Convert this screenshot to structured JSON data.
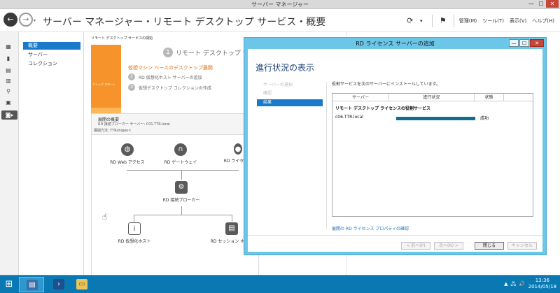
{
  "window": {
    "title": "サーバー マネージャー",
    "minimize": "—",
    "maximize": "☐",
    "close": "✕"
  },
  "header": {
    "back": "←",
    "forward": "→",
    "nav_dropdown": "▾",
    "breadcrumb": "サーバー マネージャー・リモート デスクトップ サービス・概要",
    "refresh_icon": "⟳",
    "flag_icon": "⚑",
    "menus": [
      "管理(M)",
      "ツール(T)",
      "表示(V)",
      "ヘルプ(H)"
    ]
  },
  "nav": {
    "items": [
      "概要",
      "サーバー",
      "コレクション"
    ]
  },
  "overview": {
    "section_title": "リモート デスクトップ サービスの開始",
    "tile_quickstart": "クイック スタート",
    "tile_learn": "詳細情報",
    "step1_num": "1",
    "step1": "リモート デスクトップ サ",
    "sub_title": "仮想マシン ベースのデスクトップ展開",
    "step2_num": "2",
    "step2": "RD 仮想化ホスト サーバーの追加",
    "step3_num": "3",
    "step3": "仮想デスクトップ コレクションの作成"
  },
  "deploy": {
    "title": "展開の概要",
    "broker_line": "RD 接続ブローカー サーバー: C01.TTR.local",
    "method_line": "展開方法: TTRshigeo-t",
    "nodes": {
      "web": "RD Web アクセス",
      "gateway": "RD ゲートウェイ",
      "license": "RD ライセンス",
      "broker": "RD 接続ブローカー",
      "virt": "RD 仮想化ホスト",
      "session": "RD セッション ホスト"
    }
  },
  "dialog": {
    "title": "RD ライセンス サーバーの追加",
    "heading": "進行状況の表示",
    "steps": [
      "サーバーの選択",
      "確認",
      "結果"
    ],
    "description": "役割サービスを次のサーバーにインストールしています。",
    "columns": [
      "サーバー",
      "進行状況",
      "状態"
    ],
    "group": "リモート デスクトップ ライセンスの役割サービス",
    "rows": [
      {
        "server": "c06.TTR.local",
        "progress": 1.0,
        "status": "成功"
      }
    ],
    "link": "展開の RD ライセンス プロパティの確認",
    "buttons": {
      "prev": "< 前へ(P)",
      "next": "次へ(N) >",
      "close": "閉じる",
      "cancel": "キャンセル"
    }
  },
  "taskbar": {
    "start_icon": "⊞",
    "tray": [
      "▲",
      "🖧",
      "🔊"
    ],
    "time": "13:36",
    "date": "2014/05/18"
  },
  "colors": {
    "accent_blue": "#1979ca",
    "orange_tile": "#f6942b",
    "dialog_frame": "#6bc6e8",
    "progress_fill": "#0e6e8e",
    "taskbar": "#0a79b3"
  }
}
